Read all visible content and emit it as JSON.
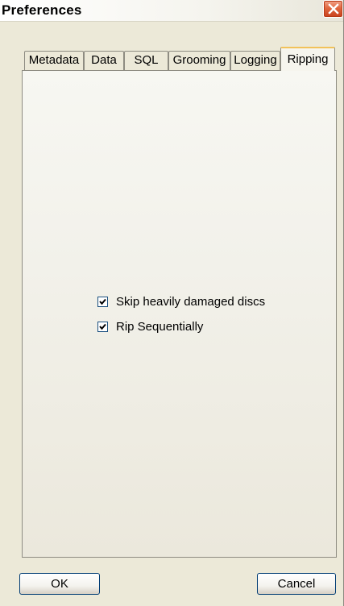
{
  "window": {
    "title": "Preferences"
  },
  "tabs": [
    {
      "label": "Metadata",
      "active": false
    },
    {
      "label": "Data",
      "active": false
    },
    {
      "label": "SQL",
      "active": false
    },
    {
      "label": "Grooming",
      "active": false
    },
    {
      "label": "Logging",
      "active": false
    },
    {
      "label": "Ripping",
      "active": true
    }
  ],
  "ripping": {
    "options": [
      {
        "label": "Skip heavily damaged discs",
        "checked": true
      },
      {
        "label": "Rip Sequentially",
        "checked": true
      }
    ]
  },
  "buttons": {
    "ok_label": "OK",
    "cancel_label": "Cancel"
  },
  "colors": {
    "window_bg": "#ece9d8",
    "close_button": "#e0673f",
    "active_tab_highlight": "#f2c25a",
    "button_border": "#003c74"
  },
  "icons": {
    "close": "close-icon",
    "check": "checkmark-icon"
  }
}
